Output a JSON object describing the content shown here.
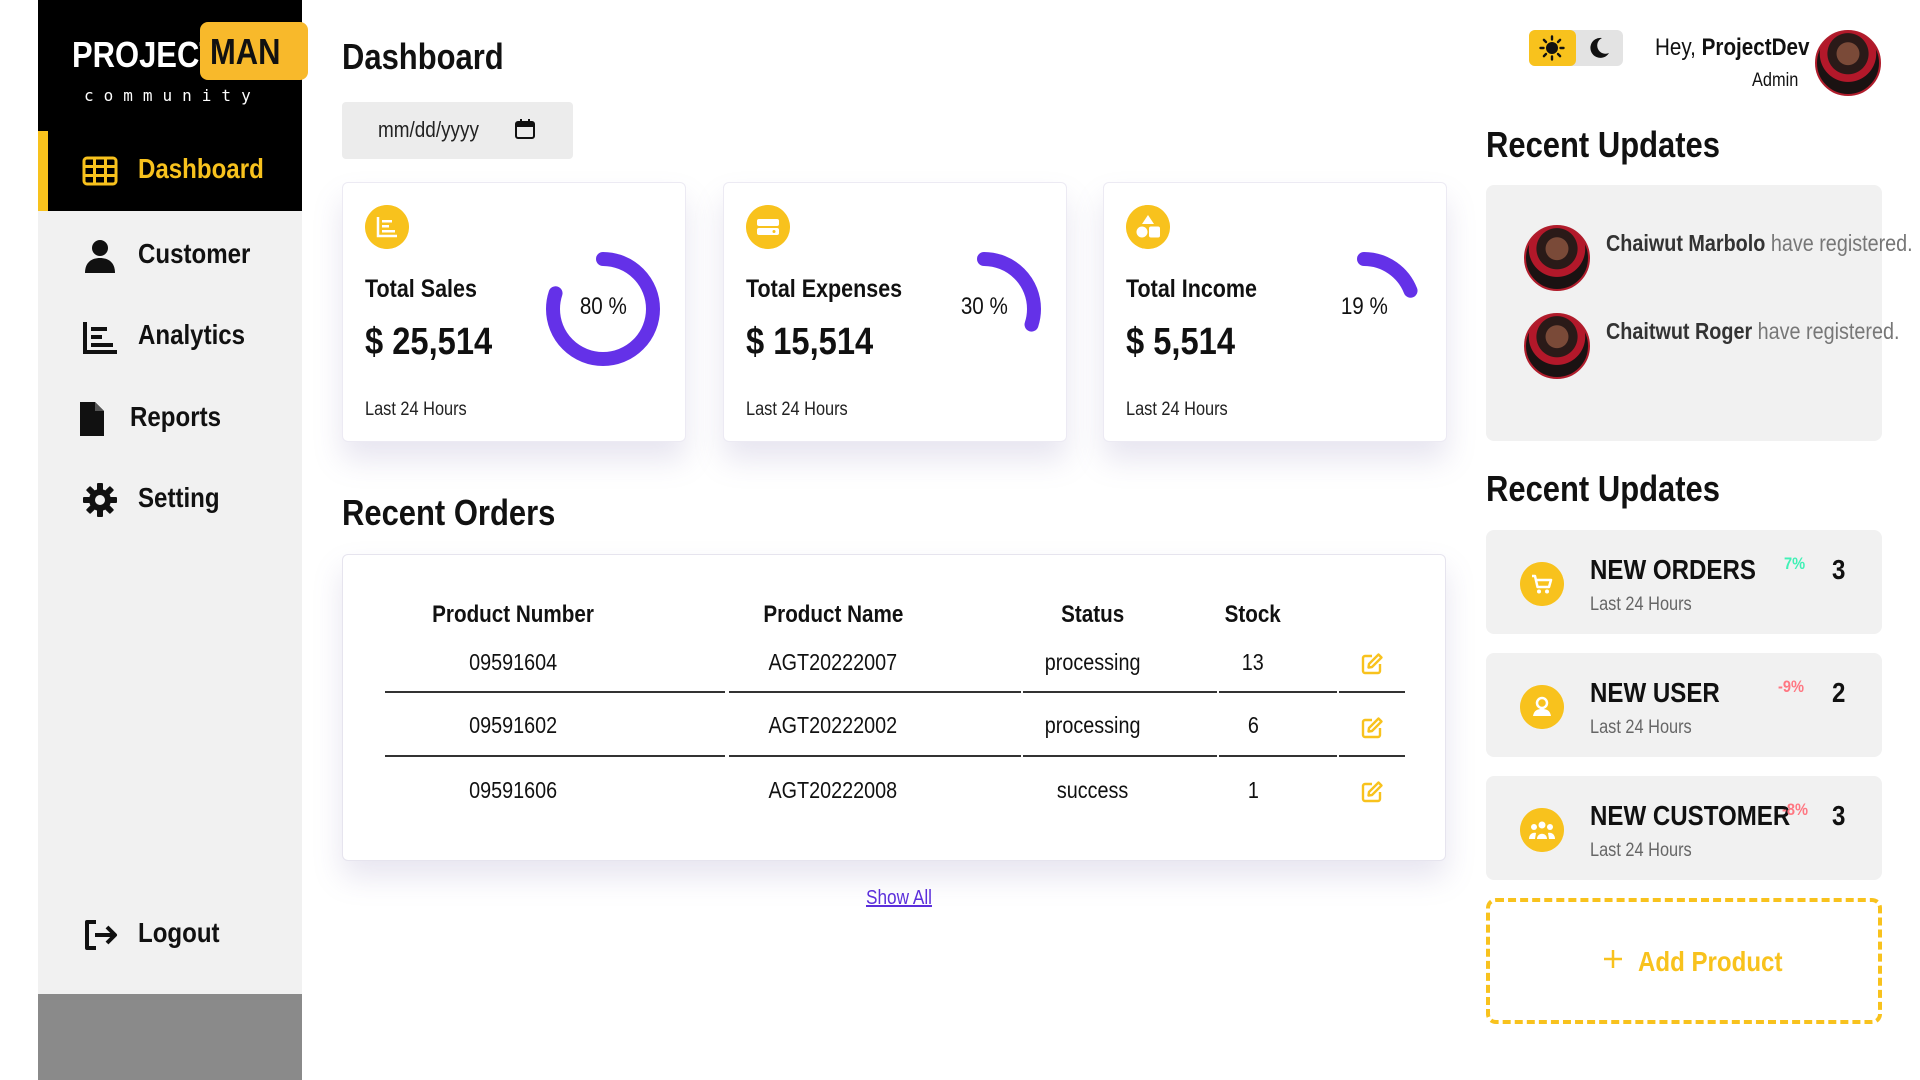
{
  "brand": {
    "word1": "PROJECT",
    "word2": "MAN",
    "tagline": "community"
  },
  "sidebar": {
    "items": [
      {
        "label": "Dashboard",
        "icon": "grid-icon",
        "active": true
      },
      {
        "label": "Customer",
        "icon": "user-icon",
        "active": false
      },
      {
        "label": "Analytics",
        "icon": "bar-chart-icon",
        "active": false
      },
      {
        "label": "Reports",
        "icon": "document-icon",
        "active": false
      },
      {
        "label": "Setting",
        "icon": "gear-icon",
        "active": false
      }
    ],
    "logout": {
      "label": "Logout",
      "icon": "logout-icon"
    }
  },
  "header": {
    "title": "Dashboard",
    "date_placeholder": "mm/dd/yyyy"
  },
  "stat_cards": [
    {
      "title": "Total Sales",
      "value": "$ 25,514",
      "percent_label": "80 %",
      "percent": 80,
      "sub": "Last 24 Hours",
      "icon": "chart-icon"
    },
    {
      "title": "Total Expenses",
      "value": "$ 15,514",
      "percent_label": "30 %",
      "percent": 30,
      "sub": "Last 24 Hours",
      "icon": "wallet-icon"
    },
    {
      "title": "Total Income",
      "value": "$ 5,514",
      "percent_label": "19 %",
      "percent": 19,
      "sub": "Last 24 Hours",
      "icon": "shapes-icon"
    }
  ],
  "orders": {
    "title": "Recent Orders",
    "columns": [
      "Product Number",
      "Product Name",
      "Status",
      "Stock"
    ],
    "rows": [
      {
        "number": "09591604",
        "name": "AGT20222007",
        "status": "processing",
        "stock": "13"
      },
      {
        "number": "09591602",
        "name": "AGT20222002",
        "status": "processing",
        "stock": "6"
      },
      {
        "number": "09591606",
        "name": "AGT20222008",
        "status": "success",
        "stock": "1"
      }
    ],
    "show_all": "Show All"
  },
  "user": {
    "greeting": "Hey,",
    "name": "ProjectDev",
    "role": "Admin"
  },
  "recent_updates": {
    "title": "Recent Updates",
    "items": [
      {
        "name": "Chaiwut Marbolo",
        "text": "have registered."
      },
      {
        "name": "Chaitwut Roger",
        "text": "have registered."
      }
    ]
  },
  "analytics": {
    "title": "Recent Updates",
    "items": [
      {
        "title": "NEW ORDERS",
        "change": "7%",
        "change_color": "#41f1b6",
        "count": "3",
        "sub": "Last 24 Hours",
        "icon": "cart-icon"
      },
      {
        "title": "NEW USER",
        "change": "-9%",
        "change_color": "#ff7782",
        "count": "2",
        "sub": "Last 24 Hours",
        "icon": "user-icon"
      },
      {
        "title": "NEW CUSTOMER",
        "change": "-8%",
        "change_color": "#ff7782",
        "count": "3",
        "sub": "Last 24 Hours",
        "icon": "group-icon"
      }
    ]
  },
  "add_product": {
    "label": "Add Product"
  },
  "colors": {
    "accent": "#f8c21d",
    "ring": "#6431e8",
    "positive": "#41f1b6",
    "negative": "#ff7782"
  }
}
